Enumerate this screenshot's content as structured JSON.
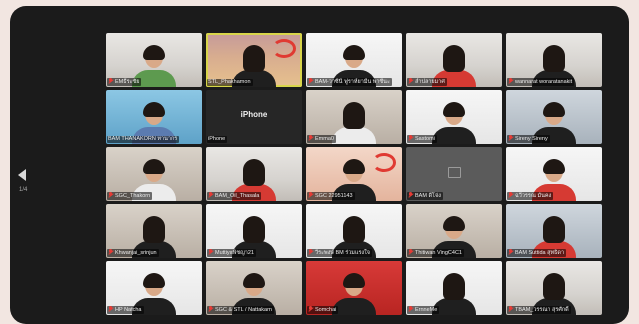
{
  "navigation": {
    "prev_icon": "chevron-left-icon",
    "page_indicator": "1/4"
  },
  "participants": [
    {
      "name": "EMธีระชัย"
    },
    {
      "name": "STL_Phakhamon"
    },
    {
      "name": "BAM-วาซีนี ฟูราห์ยามีน  พาซีนะ"
    },
    {
      "name": "ลำปลายมาศ"
    },
    {
      "name": "wannarat woraratanakit"
    },
    {
      "name": "BAM THANAKORN ทานากร"
    },
    {
      "name": "iPhone",
      "tile_text": "iPhone"
    },
    {
      "name": "Emma0"
    },
    {
      "name": "Sastomi"
    },
    {
      "name": "Sireny Sireny"
    },
    {
      "name": "SGC_Thakorn"
    },
    {
      "name": "BAM_Oil_Thasala"
    },
    {
      "name": "SGC 22951143"
    },
    {
      "name": "BAM ดีโจ่ง"
    },
    {
      "name": "ฉวีวรรณ มั่นคง"
    },
    {
      "name": "Khwanjai_srinjun"
    },
    {
      "name": "Muttiyaพิชญา21"
    },
    {
      "name": "วีระพงษ์ BM ร่วมแรงใจ"
    },
    {
      "name": "Thitiwan VingC4C1"
    },
    {
      "name": "BAM Suttida สุทธิดา"
    },
    {
      "name": "HP Natcha"
    },
    {
      "name": "SGC & STL"
    },
    {
      "name": "Nattakarn"
    },
    {
      "name": "Somchai"
    },
    {
      "name": "ErnneMe"
    },
    {
      "name": "TBAM_วรรณา สุรศักดิ์"
    }
  ],
  "colors": {
    "window_bg": "#1b1b1b",
    "active_speaker_border": "#d8d54a",
    "muted_icon": "#e53b35"
  }
}
